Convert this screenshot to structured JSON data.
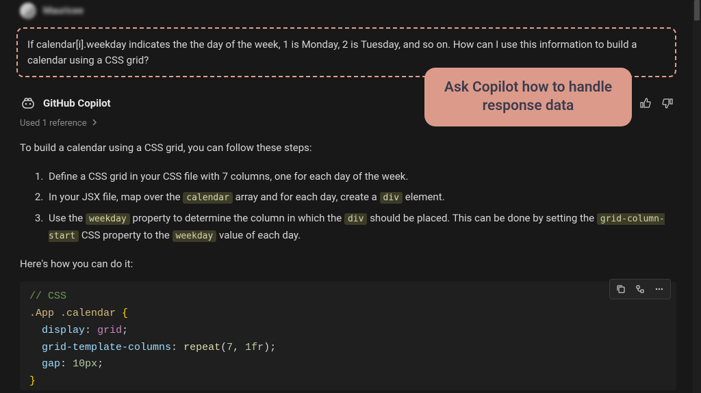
{
  "user": {
    "name": "Mauricee"
  },
  "prompt": {
    "text": "If calendar[i].weekday indicates the the day of the week, 1 is Monday, 2 is Tuesday, and so on. How can I use this information to build a calendar using a CSS grid?"
  },
  "assistant": {
    "name": "GitHub Copilot",
    "references_label": "Used 1 reference",
    "intro": "To build a calendar using a CSS grid, you can follow these steps:",
    "steps": {
      "s1": {
        "text": "Define a CSS grid in your CSS file with 7 columns, one for each day of the week."
      },
      "s2": {
        "a": "In your JSX file, map over the ",
        "code1": "calendar",
        "b": " array and for each day, create a ",
        "code2": "div",
        "c": " element."
      },
      "s3": {
        "a": "Use the ",
        "code1": "weekday",
        "b": " property to determine the column in which the ",
        "code2": "div",
        "c": " should be placed. This can be done by setting the ",
        "code3": "grid-column-start",
        "d": " CSS property to the ",
        "code4": "weekday",
        "e": " value of each day."
      }
    },
    "lead": "Here's how you can do it:"
  },
  "code": {
    "comment": "// CSS",
    "selector": ".App .calendar",
    "prop_display": "display",
    "val_display": "grid",
    "prop_gtc": "grid-template-columns",
    "func_repeat": "repeat",
    "num_7": "7",
    "unit_1fr": "1fr",
    "prop_gap": "gap",
    "val_gap": "10px"
  },
  "callout": {
    "text": "Ask Copilot how to handle response data"
  }
}
